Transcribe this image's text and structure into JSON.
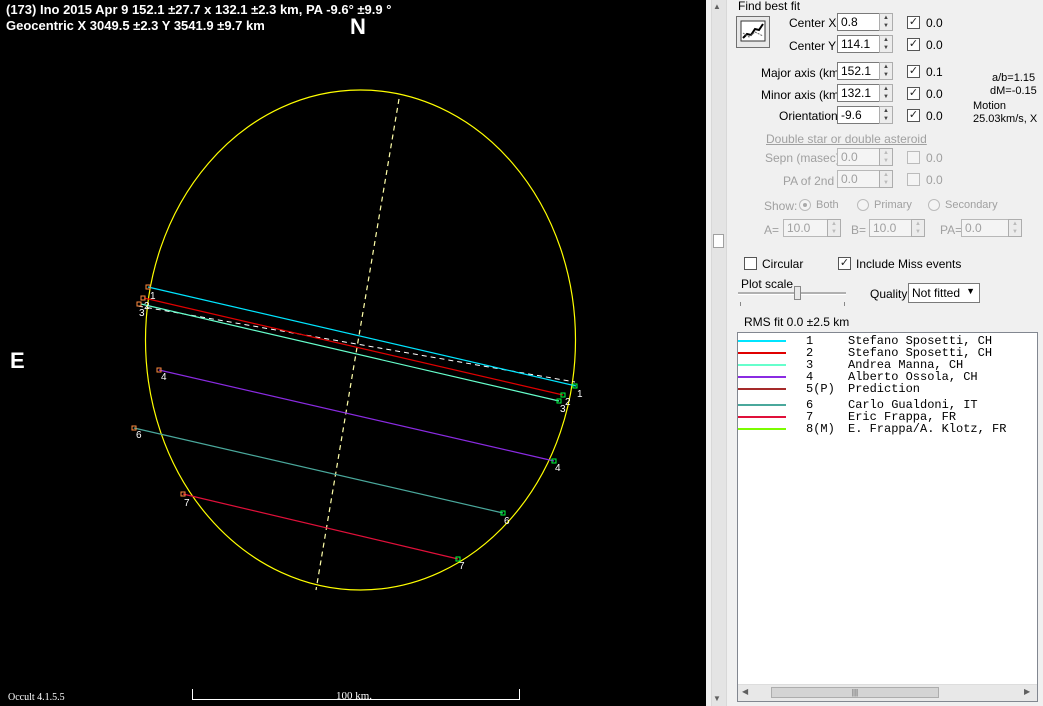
{
  "plot": {
    "title_line1": "(173) Ino  2015 Apr 9   152.1 ±27.7 x 132.1 ±2.3 km,  PA -9.6° ±9.9 °",
    "title_line2": "Geocentric  X  3049.5 ±2.3   Y 3541.9 ±9.7 km",
    "north_label": "N",
    "east_label": "E",
    "version": "Occult 4.1.5.5",
    "scale_label": "100 km.",
    "chord_labels": [
      "1",
      "2",
      "3",
      "4",
      "6",
      "7"
    ]
  },
  "panel": {
    "find_best_fit": "Find best fit",
    "center_x": {
      "label": "Center X",
      "value": "0.8",
      "checked": true,
      "sd": "0.0"
    },
    "center_y": {
      "label": "Center Y",
      "value": "114.1",
      "checked": true,
      "sd": "0.0"
    },
    "major_axis": {
      "label": "Major axis (km)",
      "value": "152.1",
      "checked": true,
      "sd": "0.1"
    },
    "minor_axis": {
      "label": "Minor axis (km)",
      "value": "132.1",
      "checked": true,
      "sd": "0.0"
    },
    "orientation": {
      "label": "Orientation",
      "value": "-9.6",
      "checked": true,
      "sd": "0.0"
    },
    "ab_ratio": "a/b=1.15",
    "dm": "dM=-0.15",
    "motion_label": "Motion",
    "motion_value": "25.03km/s, X",
    "double_star_link": "Double star  or  double asteroid",
    "sepn": {
      "label": "Sepn (masec)",
      "value": "0.0",
      "sd": "0.0"
    },
    "pa_2nd": {
      "label": "PA of 2nd",
      "value": "0.0",
      "sd": "0.0"
    },
    "show_label": "Show:",
    "show_options": [
      "Both",
      "Primary",
      "Secondary"
    ],
    "a_label": "A=",
    "a_value": "10.0",
    "b_label": "B=",
    "b_value": "10.0",
    "pa_label": "PA=",
    "pa_value": "0.0",
    "circular": {
      "label": "Circular",
      "checked": false
    },
    "include_miss": {
      "label": "Include Miss events",
      "checked": true
    },
    "plot_scale": "Plot scale",
    "quality_label": "Quality",
    "quality_value": "Not fitted",
    "rms_fit": "RMS fit  0.0 ±2.5 km",
    "observers": [
      {
        "num": "1",
        "name": "Stefano Sposetti, CH",
        "color": "#00e5ff"
      },
      {
        "num": "2",
        "name": "Stefano Sposetti, CH",
        "color": "#e00000"
      },
      {
        "num": "3",
        "name": "Andrea Manna, CH",
        "color": "#66ffcc"
      },
      {
        "num": "4",
        "name": "Alberto Ossola, CH",
        "color": "#8a2be2"
      },
      {
        "num": "5(P)",
        "name": "Prediction",
        "color": "#a52a2a"
      },
      {
        "num": "6",
        "name": "Carlo Gualdoni, IT",
        "color": "#4aa89c"
      },
      {
        "num": "7",
        "name": "Eric Frappa, FR",
        "color": "#e0103a"
      },
      {
        "num": "8(M)",
        "name": "E. Frappa/A. Klotz, FR",
        "color": "#7cfc00"
      }
    ]
  },
  "colors": {
    "ellipse": "#ffff00",
    "axis": "#ffffaa"
  }
}
